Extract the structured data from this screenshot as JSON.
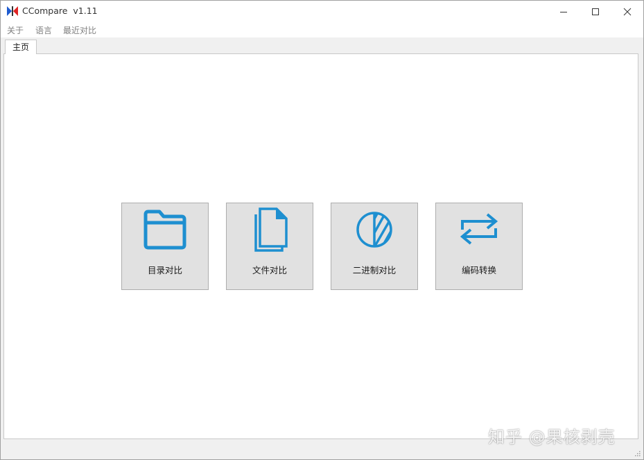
{
  "window": {
    "title": "CCompare  v1.11"
  },
  "menu": {
    "items": [
      {
        "label": "关于"
      },
      {
        "label": "语言"
      },
      {
        "label": "最近对比"
      }
    ]
  },
  "tabs": [
    {
      "label": "主页",
      "active": true
    }
  ],
  "actions": [
    {
      "label": "目录对比",
      "icon": "folder-icon"
    },
    {
      "label": "文件对比",
      "icon": "files-icon"
    },
    {
      "label": "二进制对比",
      "icon": "half-circle-icon"
    },
    {
      "label": "编码转换",
      "icon": "swap-arrows-icon"
    }
  ],
  "colors": {
    "accent": "#1e8fd0",
    "button_bg": "#e1e1e1",
    "button_border": "#adadad"
  },
  "watermark": {
    "text": "知乎 @果核剥壳"
  }
}
